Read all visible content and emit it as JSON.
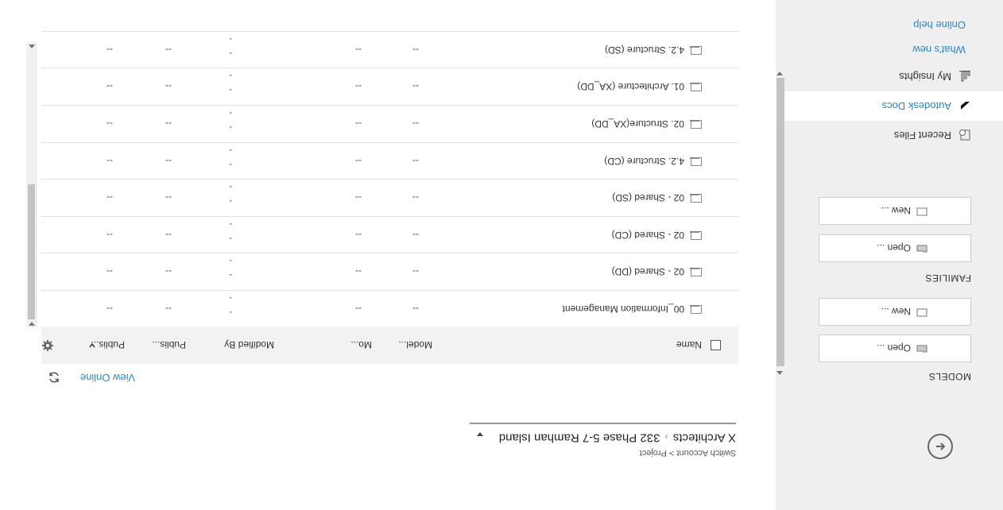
{
  "sidebar": {
    "models_label": "MODELS",
    "families_label": "FAMILIES",
    "models_open": "Open ...",
    "models_new": "New ...",
    "families_open": "Open ...",
    "families_new": "New ...",
    "nav": [
      {
        "label": "Recent Files",
        "icon": "recent-files-icon"
      },
      {
        "label": "Autodesk Docs",
        "icon": "autodesk-docs-icon",
        "active": true
      },
      {
        "label": "My Insights",
        "icon": "insights-icon"
      }
    ],
    "links": {
      "whats_new": "What's new",
      "online_help": "Online help"
    }
  },
  "header": {
    "switch_account": "Switch Account > Project",
    "account": "X Architects",
    "separator": "›",
    "project": "332 Phase 5-7 Ramhan Island"
  },
  "toolbar": {
    "view_online": "View Online"
  },
  "table": {
    "columns": {
      "name": "Name",
      "model": "Model...",
      "mo": "Mo...",
      "modified_by": "Modified By",
      "publis1": "Publis...",
      "publis2": "Publis..."
    },
    "rows": [
      {
        "name": "00_Information Management",
        "model": "--",
        "mo": "--",
        "mod1": "-",
        "mod2": "-",
        "pub1": "--",
        "pub2": "--"
      },
      {
        "name": "02 - Shared (DD)",
        "model": "--",
        "mo": "--",
        "mod1": "-",
        "mod2": "-",
        "pub1": "--",
        "pub2": "--"
      },
      {
        "name": "02 - Shared (CD)",
        "model": "--",
        "mo": "--",
        "mod1": "-",
        "mod2": "-",
        "pub1": "--",
        "pub2": "--"
      },
      {
        "name": "02 - Shared (SD)",
        "model": "--",
        "mo": "--",
        "mod1": "-",
        "mod2": "-",
        "pub1": "--",
        "pub2": "--"
      },
      {
        "name": "4.2. Structure (CD)",
        "model": "--",
        "mo": "--",
        "mod1": "-",
        "mod2": "-",
        "pub1": "--",
        "pub2": "--"
      },
      {
        "name": "02. Structure(XA_DD)",
        "model": "--",
        "mo": "--",
        "mod1": "-",
        "mod2": "-",
        "pub1": "--",
        "pub2": "--"
      },
      {
        "name": "01. Architecture (XA_DD)",
        "model": "--",
        "mo": "--",
        "mod1": "-",
        "mod2": "-",
        "pub1": "--",
        "pub2": "--"
      },
      {
        "name": "4.2. Structure (SD)",
        "model": "--",
        "mo": "--",
        "mod1": "-",
        "mod2": "-",
        "pub1": "--",
        "pub2": "--"
      }
    ]
  },
  "colors": {
    "accent": "#2a86c9",
    "sidebar_bg": "#efefef",
    "header_bg": "#f2f2f2"
  }
}
